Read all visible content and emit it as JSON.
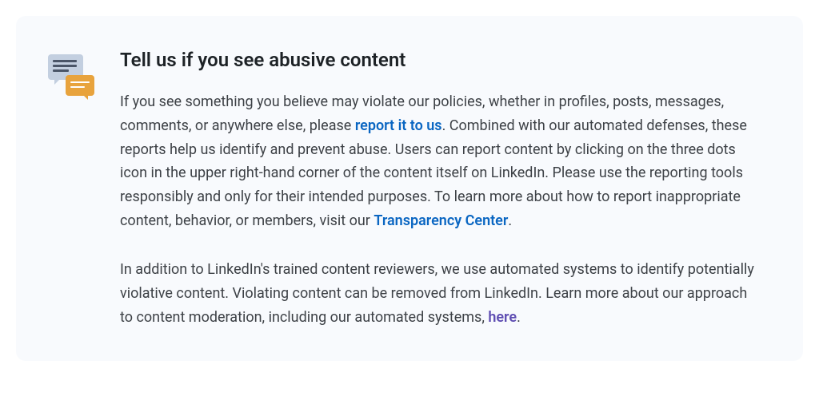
{
  "card": {
    "heading": "Tell us if you see abusive content",
    "para1": {
      "text_before_link1": "If you see something you believe may violate our policies, whether in profiles, posts, messages, comments, or anywhere else, please ",
      "link1_text": "report it to us",
      "text_after_link1": ". Combined with our automated defenses, these reports help us identify and prevent abuse. Users can report content by clicking on the three dots icon in the upper right-hand corner of the content itself on LinkedIn. Please use the reporting tools responsibly and only for their intended purposes. To learn more about how to report inappropriate content, behavior, or members, visit our ",
      "link2_text": "Transparency Center",
      "text_after_link2": "."
    },
    "para2": {
      "text_before_link": "In addition to LinkedIn's trained content reviewers, we use automated systems to identify potentially violative content. Violating content can be removed from LinkedIn. Learn more about our approach to content moderation, including our automated systems, ",
      "link_text": "here",
      "text_after_link": "."
    }
  }
}
